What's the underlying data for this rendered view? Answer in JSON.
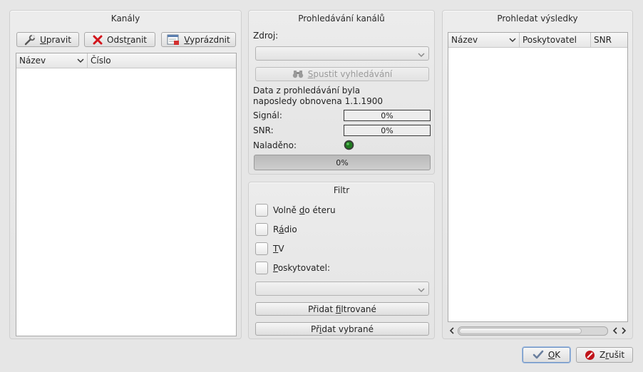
{
  "channels": {
    "title": "Kanály",
    "buttons": {
      "edit": {
        "pre": "",
        "u": "U",
        "post": "pravit"
      },
      "remove": {
        "pre": "Odst",
        "u": "r",
        "post": "anit"
      },
      "clear": {
        "pre": "",
        "u": "V",
        "post": "yprázdnit"
      }
    },
    "columns": [
      "Název",
      "Číslo"
    ]
  },
  "scan": {
    "title": "Prohledávání kanálů",
    "source_label": "Zdroj:",
    "source_value": "",
    "start_button": {
      "pre": "",
      "u": "S",
      "post": "pustit vyhledávání"
    },
    "last_updated": "Data z prohledávání byla naposledy obnovena 1.1.1900",
    "signal_label": "Signál:",
    "signal_value": "0%",
    "snr_label": "SNR:",
    "snr_value": "0%",
    "tuned_label": "Naladěno:",
    "progress_value": "0%"
  },
  "filter": {
    "title": "Filtr",
    "options": {
      "free": {
        "pre": "Volně ",
        "u": "d",
        "post": "o éteru"
      },
      "radio": {
        "pre": "R",
        "u": "á",
        "post": "dio"
      },
      "tv": {
        "pre": "",
        "u": "T",
        "post": "V"
      },
      "provider": {
        "pre": "",
        "u": "P",
        "post": "oskytovatel:"
      }
    },
    "provider_value": "",
    "add_filtered": {
      "pre": "Přidat ",
      "u": "f",
      "post": "iltrované"
    },
    "add_selected": {
      "pre": "Př",
      "u": "i",
      "post": "dat vybrané"
    }
  },
  "results": {
    "title": "Prohledat výsledky",
    "columns": [
      "Název",
      "Poskytovatel",
      "SNR"
    ]
  },
  "dialog": {
    "ok": {
      "pre": "",
      "u": "O",
      "post": "K"
    },
    "cancel": {
      "pre": "Z",
      "u": "r",
      "post": "ušit"
    }
  },
  "colors": {
    "tuned_led": "#1f7a1f",
    "cancel_icon": "#c0141a",
    "ok_icon": "#2f6fb3"
  }
}
